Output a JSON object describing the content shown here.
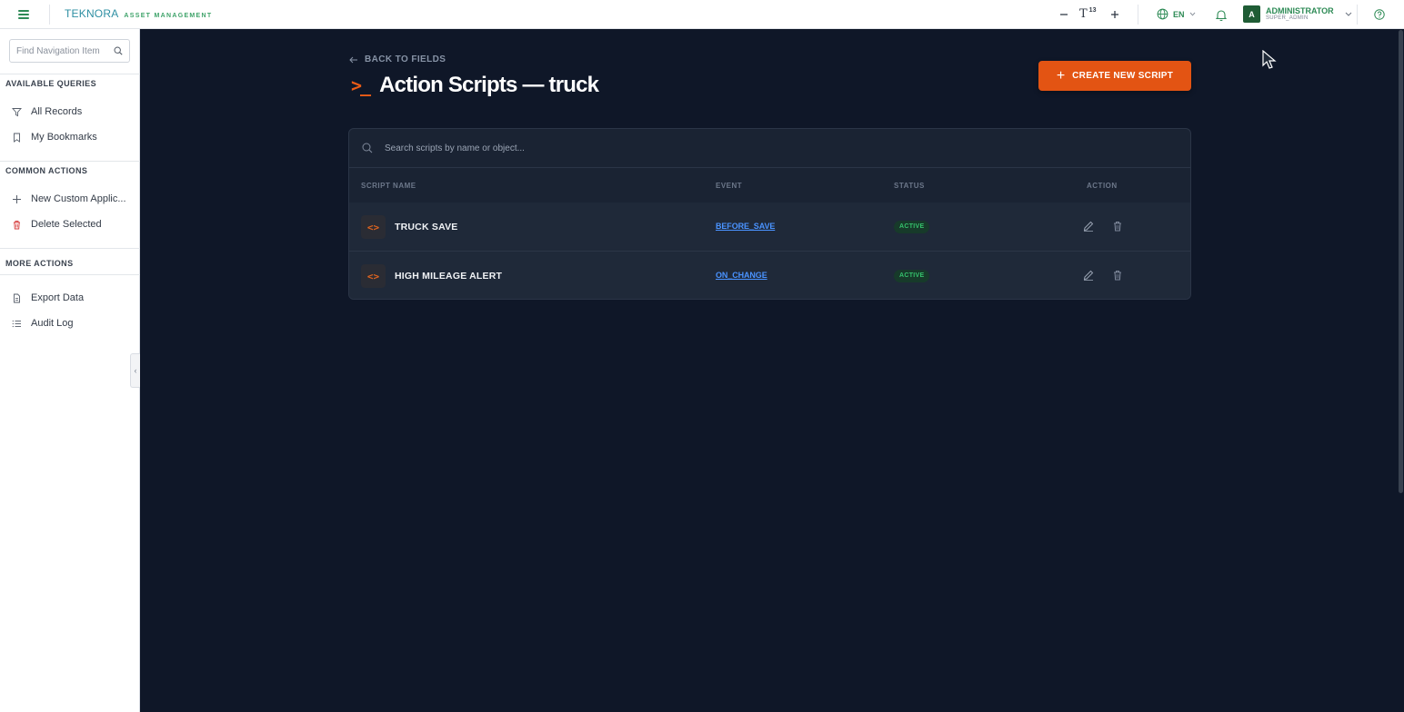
{
  "topbar": {
    "brand_logo": "TEKNORA",
    "brand_subtitle": "ASSET MANAGEMENT",
    "font_size": "13",
    "language": "EN",
    "user_name": "ADMINISTRATOR",
    "user_role": "SUPER_ADMIN",
    "user_initial": "A",
    "icons": [
      "menu-icon",
      "zoom-out-icon",
      "font-size-icon",
      "zoom-in-icon",
      "globe-icon",
      "bell-icon",
      "chevron-down-icon",
      "help-icon"
    ]
  },
  "sidebar": {
    "search_placeholder": "Find Navigation Item",
    "sections": [
      {
        "title": "AVAILABLE QUERIES",
        "items": [
          {
            "label": "All Records",
            "icon": "filter-icon"
          },
          {
            "label": "My Bookmarks",
            "icon": "bookmark-icon"
          }
        ]
      },
      {
        "title": "COMMON ACTIONS",
        "items": [
          {
            "label": "New Custom Applic...",
            "icon": "plus-icon"
          },
          {
            "label": "Delete Selected",
            "icon": "trash-icon"
          }
        ]
      },
      {
        "title": "MORE ACTIONS",
        "items": [
          {
            "label": "Export Data",
            "icon": "export-icon"
          },
          {
            "label": "Audit Log",
            "icon": "list-icon"
          }
        ]
      }
    ]
  },
  "main": {
    "back_label": "BACK TO FIELDS",
    "title": "Action Scripts — truck",
    "create_button": "CREATE NEW SCRIPT",
    "search_placeholder": "Search scripts by name or object...",
    "columns": [
      "SCRIPT NAME",
      "EVENT",
      "STATUS",
      "ACTION"
    ],
    "rows": [
      {
        "name": "TRUCK SAVE",
        "event": "BEFORE_SAVE",
        "status": "ACTIVE"
      },
      {
        "name": "HIGH MILEAGE ALERT",
        "event": "ON_CHANGE",
        "status": "ACTIVE"
      }
    ]
  },
  "colors": {
    "accent_orange": "#e35413",
    "brand_green": "#2d8a55",
    "event_blue": "#4a93ff",
    "status_green": "#35c26c",
    "background": "#0f1728"
  }
}
